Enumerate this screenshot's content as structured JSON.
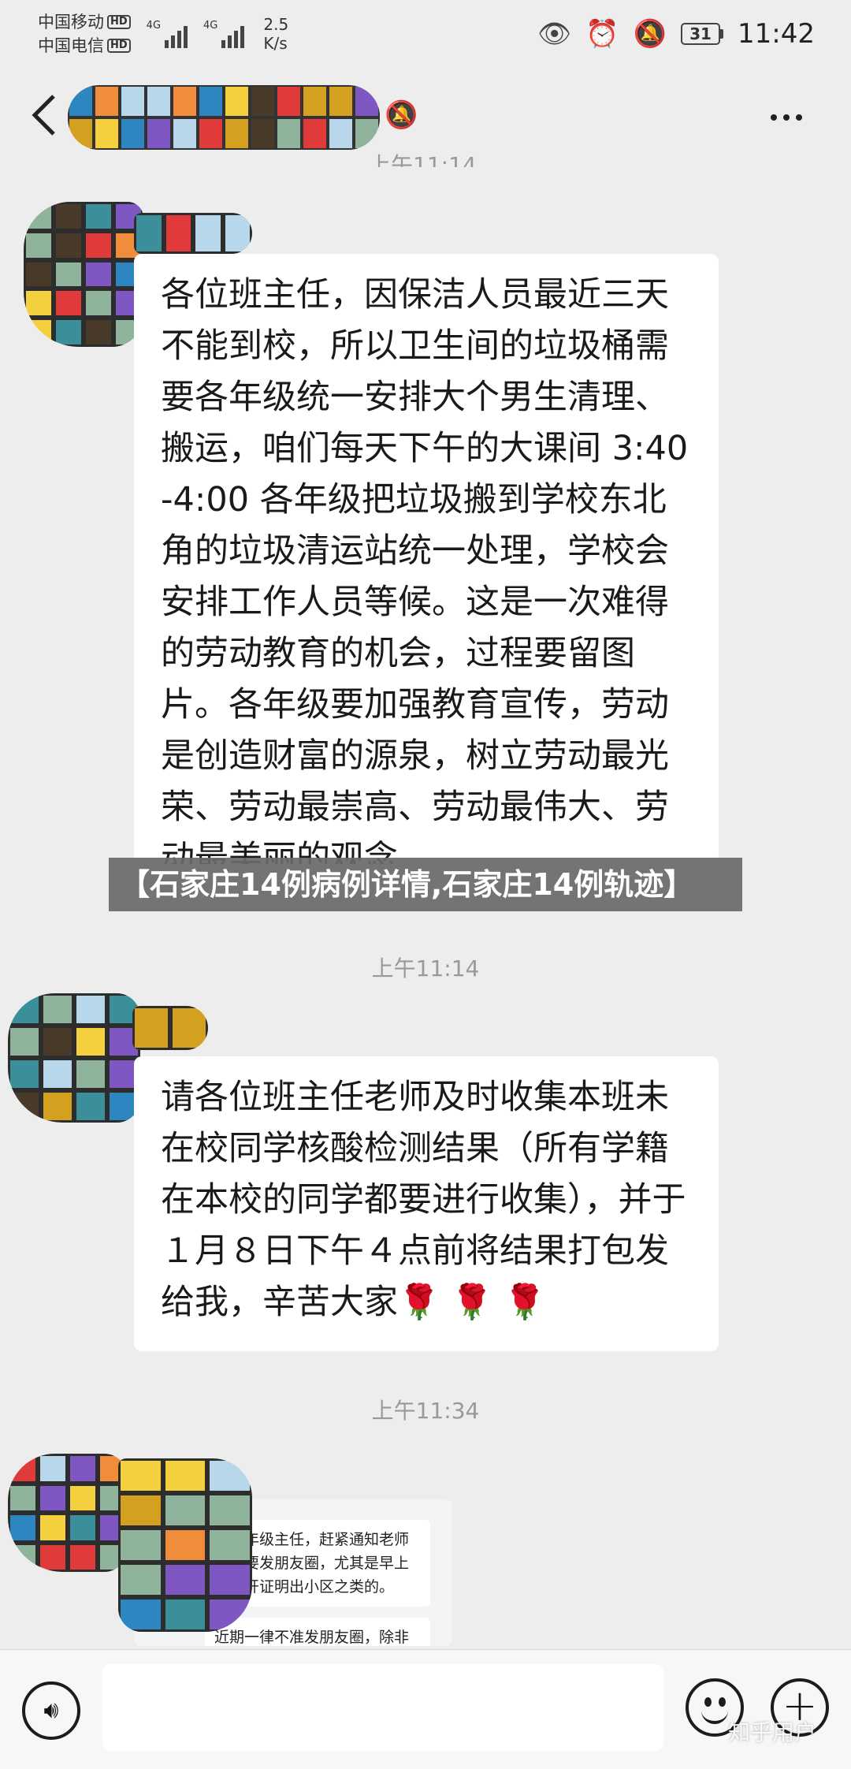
{
  "status_bar": {
    "carrier_1": "中国移动",
    "carrier_2": "中国电信",
    "hd_badge": "HD",
    "network_1": "4G",
    "network_2": "4G",
    "speed_value": "2.5",
    "speed_unit": "K/s",
    "battery": "31",
    "time": "11:42"
  },
  "nav": {
    "back_icon": "chevron-left-icon",
    "mute_icon": "bell-off-icon",
    "more_icon": "more-dots-icon"
  },
  "messages": [
    {
      "text": "各位班主任，因保洁人员最近三天不能到校，所以卫生间的垃圾桶需要各年级统一安排大个男生清理、搬运，咱们每天下午的大课间 3:40-4:00 各年级把垃圾搬到学校东北角的垃圾清运站统一处理，学校会安排工作人员等候。这是一次难得的劳动教育的机会，过程要留图片。各年级要加强教育宣传，劳动是创造财富的源泉，树立劳动最光荣、劳动最崇高、劳动最伟大、劳动最美丽的观念"
    },
    {
      "time": "上午11:14",
      "text": "请各位班主任老师及时收集本班未在校同学核酸检测结果（所有学籍在本校的同学都要进行收集），并于１月８日下午４点前将结果打包发给我，辛苦大家",
      "emoji": "🌹 🌹 🌹"
    },
    {
      "time": "上午11:34",
      "image_text_1": "各位年级主任，赶紧通知老师们不要发朋友圈，尤其是早上学校开证明出小区之类的。",
      "image_text_2": "近期一律不准发朋友圈，除非"
    }
  ],
  "overlay_headline": "【石家庄14例病例详情,石家庄14例轨迹】",
  "input_bar": {
    "voice_icon": "voice-icon",
    "emoji_icon": "smile-icon",
    "plus_icon": "plus-icon"
  },
  "watermark": "知乎用户",
  "colors": {
    "background": "#ededed",
    "bubble": "#ffffff",
    "overlay": "#696969",
    "mosaic": [
      "#e03a3a",
      "#3a8f9a",
      "#7e57c2",
      "#d4a020",
      "#8fb39b",
      "#4a3a2a",
      "#f4d03f",
      "#2e86c1",
      "#f08c3a",
      "#b9d7ea"
    ]
  }
}
